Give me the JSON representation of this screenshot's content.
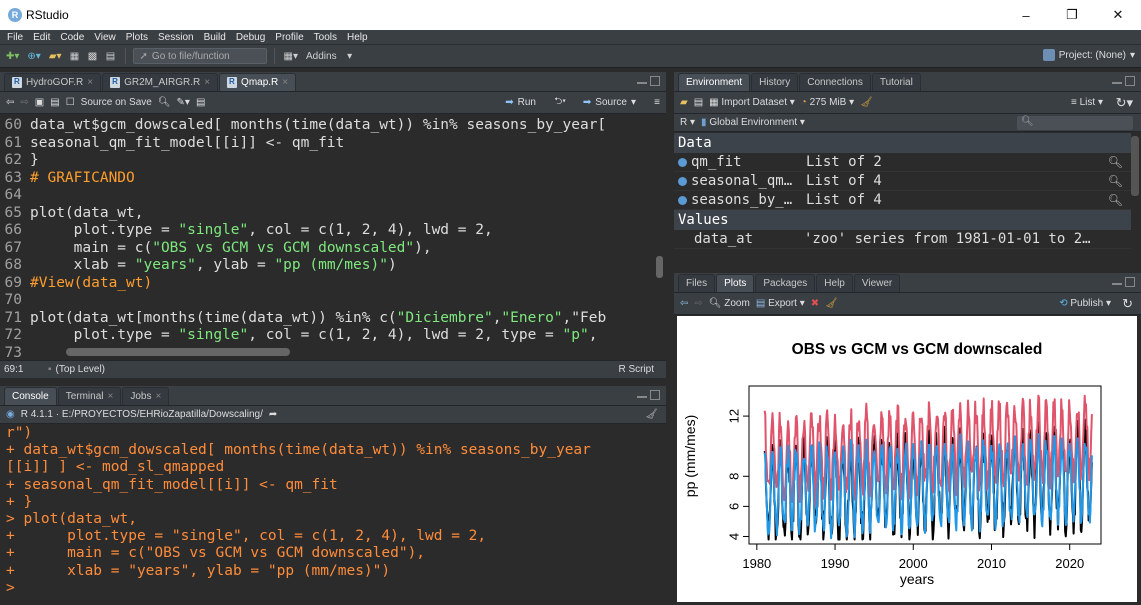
{
  "app": {
    "title": "RStudio",
    "logo_letter": "R"
  },
  "window_controls": {
    "minimize": "–",
    "maximize": "❐",
    "close": "✕"
  },
  "menu": [
    "File",
    "Edit",
    "Code",
    "View",
    "Plots",
    "Session",
    "Build",
    "Debug",
    "Profile",
    "Tools",
    "Help"
  ],
  "toolbar": {
    "goto_placeholder": "Go to file/function",
    "addins": "Addins",
    "project": "Project: (None)"
  },
  "editor": {
    "tabs": [
      {
        "label": "HydroGOF.R"
      },
      {
        "label": "GR2M_AIRGR.R"
      },
      {
        "label": "Qmap.R"
      }
    ],
    "source_on_save": "Source on Save",
    "run": "Run",
    "source": "Source",
    "lines": [
      {
        "n": "60",
        "t": "data_wt$gcm_dowscaled[ months(time(data_wt)) %in% seasons_by_year["
      },
      {
        "n": "61",
        "t": "seasonal_qm_fit_model[[i]] <- qm_fit"
      },
      {
        "n": "62",
        "t": "}"
      },
      {
        "n": "63",
        "t": "# GRAFICANDO"
      },
      {
        "n": "64",
        "t": ""
      },
      {
        "n": "65",
        "t": "plot(data_wt,"
      },
      {
        "n": "66",
        "t": "     plot.type = \"single\", col = c(1, 2, 4), lwd = 2,"
      },
      {
        "n": "67",
        "t": "     main = c(\"OBS vs GCM vs GCM downscaled\"),"
      },
      {
        "n": "68",
        "t": "     xlab = \"years\", ylab = \"pp (mm/mes)\")"
      },
      {
        "n": "69",
        "t": "#View(data_wt)"
      },
      {
        "n": "70",
        "t": ""
      },
      {
        "n": "71",
        "t": "plot(data_wt[months(time(data_wt)) %in% c(\"Diciembre\",\"Enero\",\"Feb"
      },
      {
        "n": "72",
        "t": "     plot.type = \"single\", col = c(1, 2, 4), lwd = 2, type = \"p\","
      },
      {
        "n": "73",
        "t": ""
      }
    ],
    "status_pos": "69:1",
    "status_scope": "(Top Level)",
    "status_type": "R Script"
  },
  "console": {
    "tabs": [
      {
        "label": "Console"
      },
      {
        "label": "Terminal"
      },
      {
        "label": "Jobs"
      }
    ],
    "path": "R 4.1.1 · E:/PROYECTOS/EHRioZapatilla/Dowscaling/",
    "lines": [
      "r\")",
      "+ data_wt$gcm_dowscaled[ months(time(data_wt)) %in% seasons_by_year",
      "[[i]] ] <- mod_sl_qmapped",
      "+ seasonal_qm_fit_model[[i]] <- qm_fit",
      "+ }",
      "> plot(data_wt,",
      "+      plot.type = \"single\", col = c(1, 2, 4), lwd = 2,",
      "+      main = c(\"OBS vs GCM vs GCM downscaled\"),",
      "+      xlab = \"years\", ylab = \"pp (mm/mes)\")",
      "> "
    ]
  },
  "environment": {
    "tabs": [
      {
        "label": "Environment"
      },
      {
        "label": "History"
      },
      {
        "label": "Connections"
      },
      {
        "label": "Tutorial"
      }
    ],
    "import_dataset": "Import Dataset",
    "memory": "275 MiB",
    "list_view": "List",
    "lang": "R",
    "scope": "Global Environment",
    "data_header": "Data",
    "data": [
      {
        "name": "qm_fit",
        "value": "List of  2"
      },
      {
        "name": "seasonal_qm…",
        "value": "List of  4"
      },
      {
        "name": "seasons_by_…",
        "value": "List of  4"
      }
    ],
    "values_header": "Values",
    "values": [
      {
        "name": "data_at",
        "value": "'zoo' series from 1981-01-01 to 2…"
      }
    ]
  },
  "files": {
    "tabs": [
      {
        "label": "Files"
      },
      {
        "label": "Plots"
      },
      {
        "label": "Packages"
      },
      {
        "label": "Help"
      },
      {
        "label": "Viewer"
      }
    ],
    "zoom": "Zoom",
    "export": "Export",
    "publish": "Publish"
  },
  "chart_data": {
    "type": "line",
    "title": "OBS vs GCM vs GCM downscaled",
    "xlabel": "years",
    "ylabel": "pp (mm/mes)",
    "xlim": [
      1979,
      2024
    ],
    "ylim": [
      3.5,
      14
    ],
    "xticks": [
      "1980",
      "1990",
      "2000",
      "2010",
      "2020"
    ],
    "yticks": [
      "4",
      "6",
      "8",
      "12"
    ],
    "series": [
      {
        "name": "OBS",
        "color": "#000000",
        "start": 1981,
        "end": 2022.9,
        "base": 6.9,
        "amp": 2.8,
        "trend": 0.025,
        "noise": 1.1
      },
      {
        "name": "GCM",
        "color": "#df536b",
        "start": 1981,
        "end": 2022.9,
        "base": 9.2,
        "amp": 2.4,
        "trend": 0.03,
        "noise": 0.9
      },
      {
        "name": "GCM downscaled",
        "color": "#2297e6",
        "start": 1981,
        "end": 2022.9,
        "base": 7.0,
        "amp": 2.6,
        "trend": 0.02,
        "noise": 0.7
      }
    ]
  }
}
